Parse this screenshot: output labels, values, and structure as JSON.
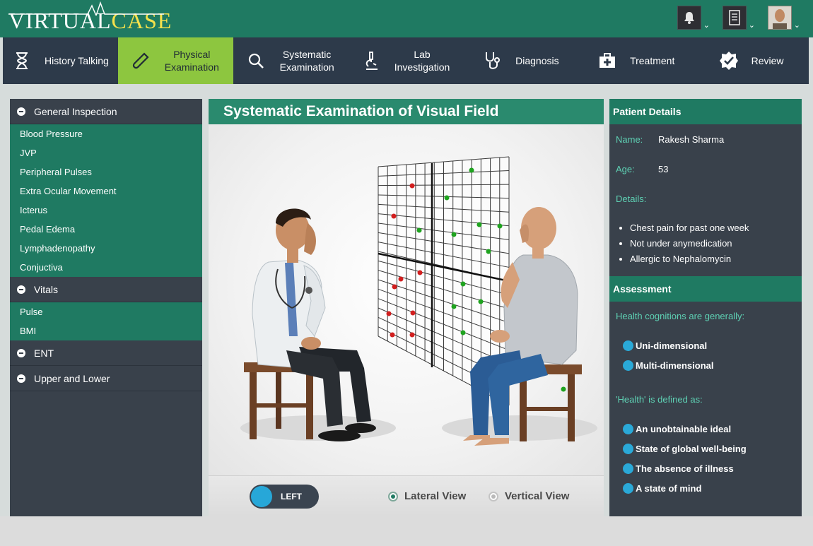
{
  "app": {
    "logo_virtual": "VIRTUAL",
    "logo_case": "CASE"
  },
  "header_icons": [
    {
      "icon": "bell-icon"
    },
    {
      "icon": "notebook-icon"
    },
    {
      "icon": "avatar"
    }
  ],
  "nav": [
    {
      "label": "History Talking",
      "icon": "hourglass-icon",
      "active": false
    },
    {
      "label": "Physical Examination",
      "icon": "thermometer-icon",
      "active": true
    },
    {
      "label": "Systematic Examination",
      "icon": "magnifier-icon",
      "active": false
    },
    {
      "label": "Lab Investigation",
      "icon": "microscope-icon",
      "active": false
    },
    {
      "label": "Diagnosis",
      "icon": "stethoscope-icon",
      "active": false
    },
    {
      "label": "Treatment",
      "icon": "first-aid-kit-icon",
      "active": false
    },
    {
      "label": "Review",
      "icon": "review-badge-icon",
      "active": false
    }
  ],
  "sidebar": {
    "sections": [
      {
        "title": "General Inspection",
        "items": [
          "Blood Pressure",
          "JVP",
          "Peripheral Pulses",
          "Extra Ocular Movement",
          "Icterus",
          "Pedal Edema",
          "Lymphadenopathy",
          "Conjuctiva"
        ]
      },
      {
        "title": "Vitals",
        "items": [
          "Pulse",
          "BMI"
        ]
      },
      {
        "title": "ENT",
        "items": []
      },
      {
        "title": "Upper and Lower",
        "items": []
      }
    ]
  },
  "main": {
    "title": "Systematic Examination of Visual Field",
    "toggle_label": "LEFT",
    "view_options": [
      {
        "label": "Lateral View",
        "selected": true
      },
      {
        "label": "Vertical View",
        "selected": false
      }
    ],
    "colors": {
      "red_point": "#d21f1f",
      "green_point": "#1fa31f"
    }
  },
  "patient": {
    "header": "Patient Details",
    "name_label": "Name:",
    "name": "Rakesh Sharma",
    "age_label": "Age:",
    "age": "53",
    "details_label": "Details:",
    "details": [
      "Chest pain for past one week",
      "Not under anymedication",
      "Allergic to Nephalomycin"
    ]
  },
  "assessment": {
    "header": "Assessment",
    "questions": [
      {
        "text": "Health cognitions are generally:",
        "options": [
          "Uni-dimensional",
          "Multi-dimensional"
        ]
      },
      {
        "text": "'Health' is defined as:",
        "options": [
          "An unobtainable ideal",
          "State of global well-being",
          "The absence of illness",
          "A state of mind"
        ]
      }
    ]
  }
}
